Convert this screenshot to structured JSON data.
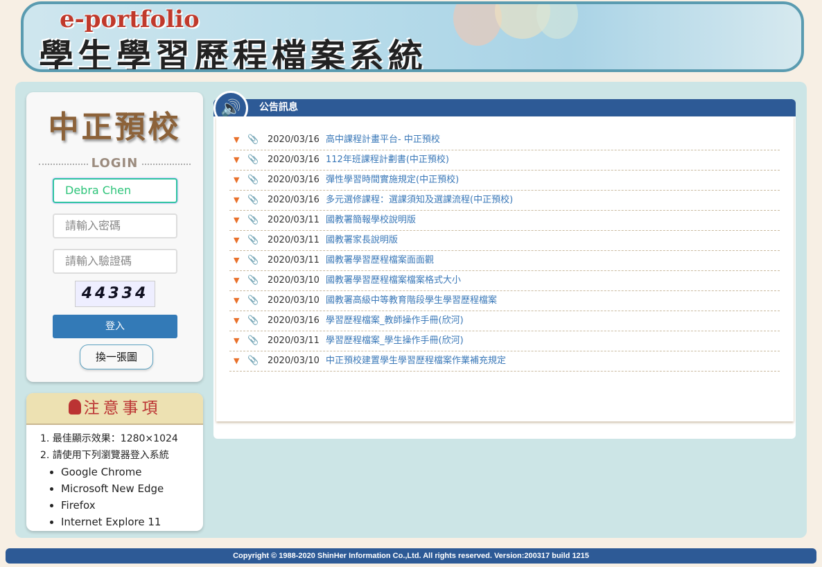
{
  "banner": {
    "subtitle": "e-portfolio",
    "title": "學生學習歷程檔案系統"
  },
  "login": {
    "school": "中正預校",
    "label": "LOGIN",
    "username_value": "Debra Chen",
    "password_placeholder": "請輸入密碼",
    "captcha_placeholder": "請輸入驗證碼",
    "captcha_text": "44334",
    "submit_label": "登入",
    "refresh_label": "換一張圖"
  },
  "notice": {
    "title": "注意事項",
    "items": [
      "1. 最佳顯示效果：1280×1024",
      "2. 請使用下列瀏覽器登入系統"
    ],
    "browsers": [
      "Google Chrome",
      "Microsoft New Edge",
      "Firefox",
      "Internet Explore 11"
    ]
  },
  "announcements": {
    "title": "公告訊息",
    "rows": [
      {
        "date": "2020/03/16",
        "title": "高中課程計畫平台- 中正預校"
      },
      {
        "date": "2020/03/16",
        "title": "112年班課程計劃書(中正預校)"
      },
      {
        "date": "2020/03/16",
        "title": "彈性學習時間實施規定(中正預校)"
      },
      {
        "date": "2020/03/16",
        "title": "多元選修課程：選課須知及選課流程(中正預校)"
      },
      {
        "date": "2020/03/11",
        "title": "國教署簡報學校說明版"
      },
      {
        "date": "2020/03/11",
        "title": "國教署家長說明版"
      },
      {
        "date": "2020/03/11",
        "title": "國教署學習歷程檔案面面觀"
      },
      {
        "date": "2020/03/10",
        "title": "國教署學習歷程檔案檔案格式大小"
      },
      {
        "date": "2020/03/10",
        "title": "國教署高級中等教育階段學生學習歷程檔案"
      },
      {
        "date": "2020/03/16",
        "title": "學習歷程檔案_教師操作手冊(欣河)"
      },
      {
        "date": "2020/03/11",
        "title": "學習歷程檔案_學生操作手冊(欣河)"
      },
      {
        "date": "2020/03/10",
        "title": "中正預校建置學生學習歷程檔案作業補充規定"
      }
    ]
  },
  "footer": {
    "text": "Copyright © 1988-2020 ShinHer Information Co.,Ltd. All rights reserved. Version:200317 build 1215"
  },
  "colors": {
    "primary": "#2d5a96",
    "button": "#337ab7",
    "link": "#3a78b8",
    "panel": "#cce5e6"
  }
}
